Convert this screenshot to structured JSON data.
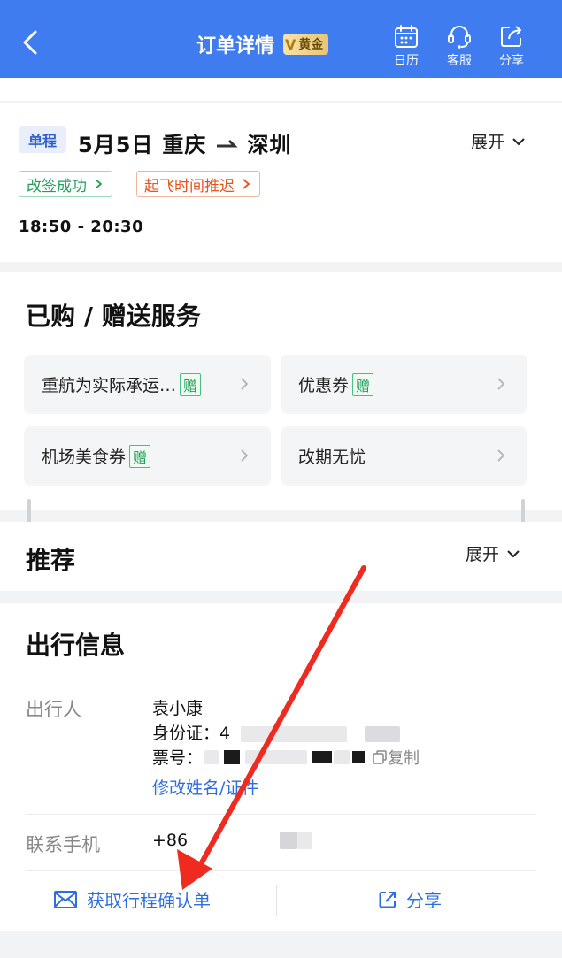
{
  "header": {
    "title": "订单详情",
    "badge_text": "黄金",
    "calendar_label": "日历",
    "service_label": "客服",
    "share_label": "分享",
    "bg_color": "#3f7cf0"
  },
  "flight": {
    "tag": "单程",
    "date": "5月5日",
    "from": "重庆",
    "to": "深圳",
    "expand_label": "展开",
    "status_changed": "改签成功",
    "status_delay": "起飞时间推迟",
    "time_range": "18:50  -  20:30"
  },
  "services": {
    "title": "已购 / 赠送服务",
    "gift_label": "赠",
    "items": [
      {
        "label": "重航为实际承运…",
        "gift": true
      },
      {
        "label": "优惠券",
        "gift": true
      },
      {
        "label": "机场美食券",
        "gift": true
      },
      {
        "label": "改期无忧",
        "gift": false
      }
    ]
  },
  "recommend": {
    "title": "推荐",
    "expand_label": "展开"
  },
  "travel": {
    "title": "出行信息",
    "traveler_label": "出行人",
    "traveler_name": "袁小康",
    "id_label": "身份证：",
    "id_value": "4",
    "ticket_label": "票号：",
    "copy_label": "复制",
    "edit_link": "修改姓名/证件",
    "phone_label": "联系手机",
    "phone_prefix": "+86",
    "get_itinerary": "获取行程确认单",
    "share": "分享"
  }
}
